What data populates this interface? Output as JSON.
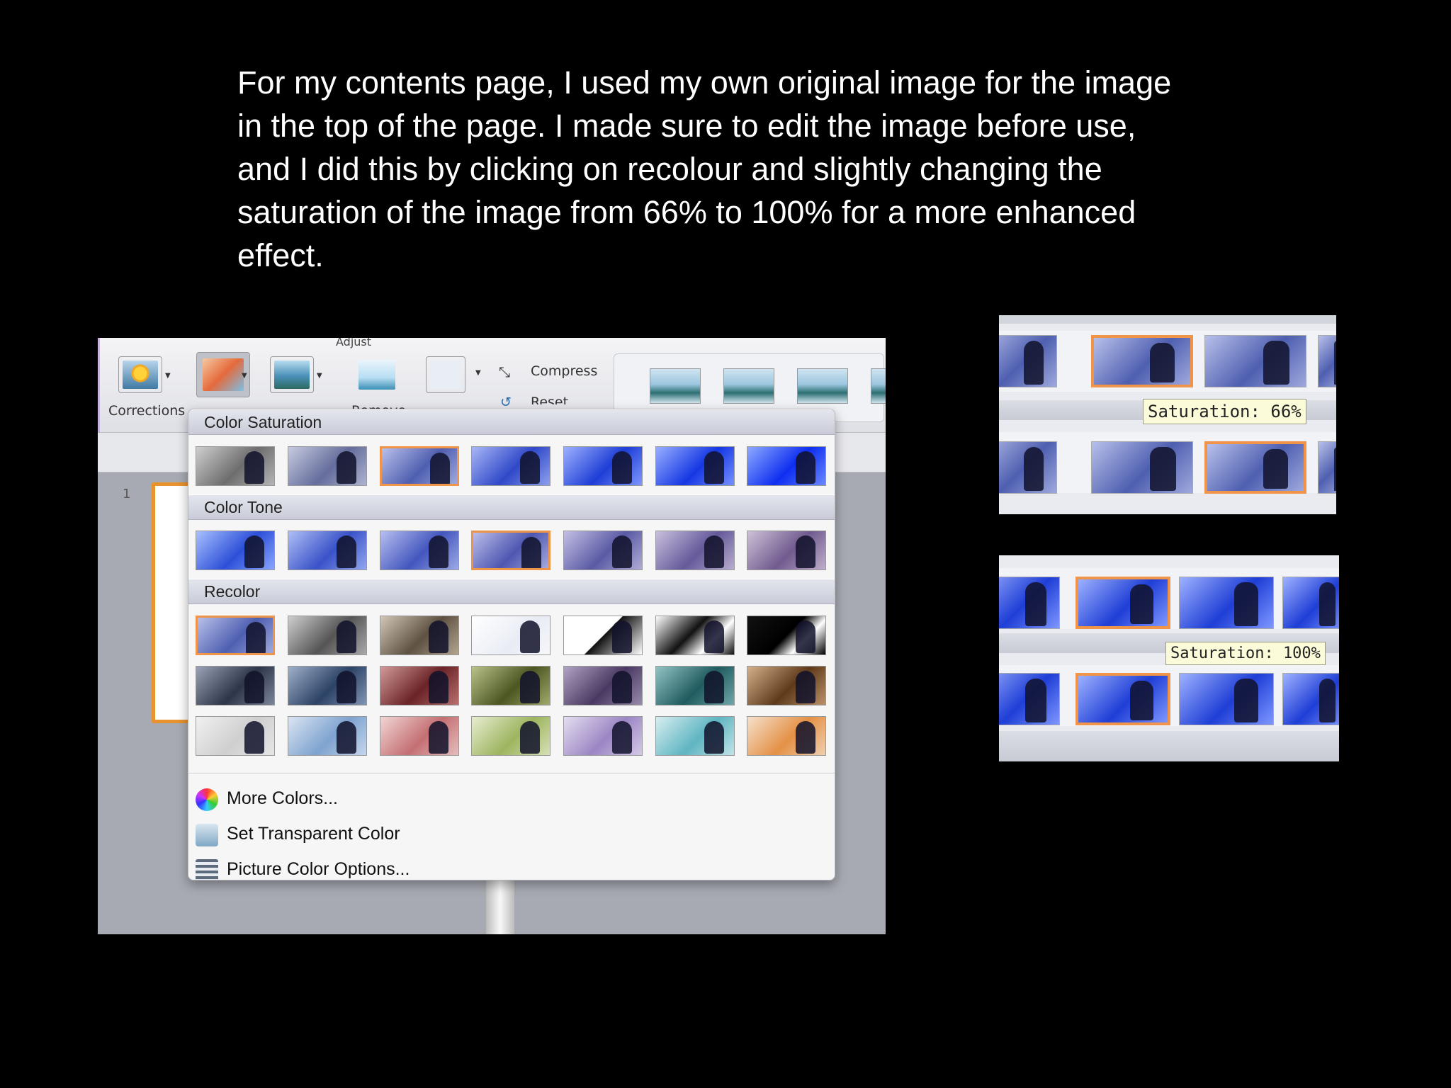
{
  "caption": {
    "lines": [
      "For my contents page, I used my own original image for the image",
      "in the top of the page. I made sure to edit the image before use,",
      "and I did this by clicking on recolour and slightly changing the",
      "saturation of the image from 66% to 100% for a more enhanced",
      "effect."
    ]
  },
  "ribbon": {
    "group_label": "Adjust",
    "corrections_label": "Corrections",
    "remove_label": "Remove",
    "compress_label": "Compress",
    "reset_label": "Reset"
  },
  "slide_panel": {
    "slide_number": "1"
  },
  "menu": {
    "sections": [
      {
        "title": "Color Saturation",
        "selected_index": 2
      },
      {
        "title": "Color Tone",
        "selected_index": 3
      },
      {
        "title": "Recolor",
        "selected_index": 0
      }
    ],
    "items": [
      {
        "label": "More Colors...",
        "icon": "color-wheel-icon"
      },
      {
        "label": "Set Transparent Color",
        "icon": "transparent-color-icon"
      },
      {
        "label": "Picture Color Options...",
        "icon": "color-options-icon"
      }
    ]
  },
  "crops": {
    "top_tooltip": "Saturation: 66%",
    "bottom_tooltip": "Saturation: 100%",
    "top_heading_fragment": "tion"
  },
  "colors": {
    "selection": "#ef9449",
    "tooltip_bg": "#fbfbd9",
    "menu_bg": "#f6f6f7"
  }
}
